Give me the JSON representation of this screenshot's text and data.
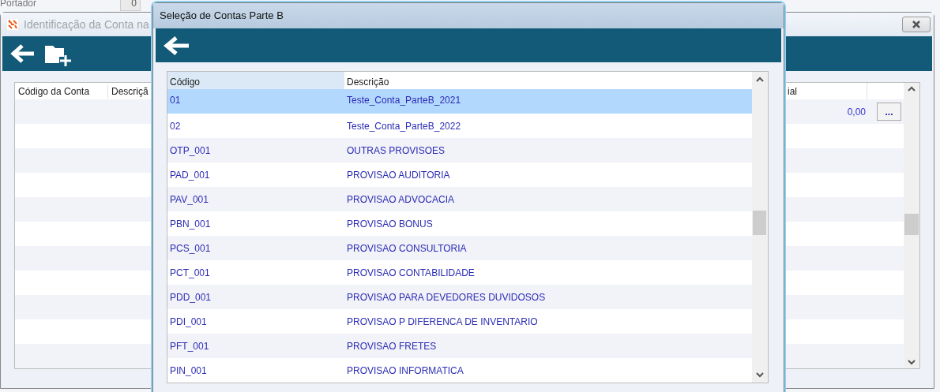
{
  "background": {
    "label": "Portador",
    "value": "0"
  },
  "main_window": {
    "title": "Identificação da Conta na",
    "columns": [
      "Código da Conta",
      "Descriçã",
      "ial"
    ],
    "rows": [
      {
        "value": "0,00",
        "button": "..."
      }
    ]
  },
  "dialog": {
    "title": "Seleção de Contas Parte B",
    "columns": [
      "Código",
      "Descrição"
    ],
    "rows": [
      {
        "code": "01",
        "description": "Teste_Conta_ParteB_2021",
        "selected": true
      },
      {
        "code": "02",
        "description": "Teste_Conta_ParteB_2022",
        "selected": false
      },
      {
        "code": "OTP_001",
        "description": "OUTRAS PROVISOES",
        "selected": false
      },
      {
        "code": "PAD_001",
        "description": "PROVISAO AUDITORIA",
        "selected": false
      },
      {
        "code": "PAV_001",
        "description": "PROVISAO ADVOCACIA",
        "selected": false
      },
      {
        "code": "PBN_001",
        "description": "PROVISAO BONUS",
        "selected": false
      },
      {
        "code": "PCS_001",
        "description": "PROVISAO CONSULTORIA",
        "selected": false
      },
      {
        "code": "PCT_001",
        "description": "PROVISAO CONTABILIDADE",
        "selected": false
      },
      {
        "code": "PDD_001",
        "description": "PROVISAO PARA DEVEDORES DUVIDOSOS",
        "selected": false
      },
      {
        "code": "PDI_001",
        "description": "PROVISAO P DIFERENCA DE INVENTARIO",
        "selected": false
      },
      {
        "code": "PFT_001",
        "description": "PROVISAO FRETES",
        "selected": false
      },
      {
        "code": "PIN_001",
        "description": "PROVISAO INFORMATICA",
        "selected": false
      }
    ]
  }
}
